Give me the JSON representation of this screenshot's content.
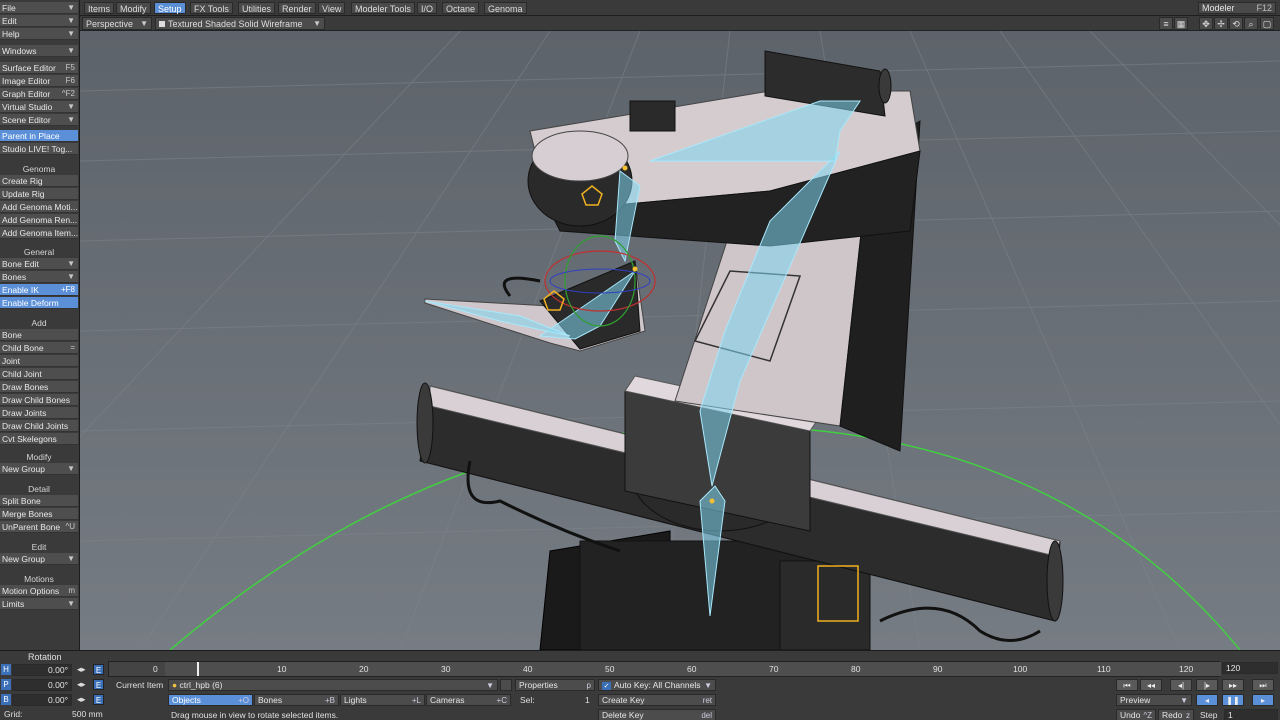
{
  "left_panel": {
    "menus": [
      {
        "label": "File"
      },
      {
        "label": "Edit"
      },
      {
        "label": "Help"
      },
      {
        "label": "Windows"
      }
    ],
    "editors": [
      {
        "label": "Surface Editor",
        "shortcut": "F5"
      },
      {
        "label": "Image Editor",
        "shortcut": "F6"
      },
      {
        "label": "Graph Editor",
        "shortcut": "^F2"
      },
      {
        "label": "Virtual Studio",
        "shortcut": ""
      },
      {
        "label": "Scene Editor",
        "shortcut": ""
      }
    ],
    "parent_in_place": "Parent in Place",
    "studio_live": "Studio LIVE! Tog...",
    "genoma_header": "Genoma",
    "genoma_items": [
      "Create Rig",
      "Update Rig",
      "Add Genoma Moti...",
      "Add Genoma Ren...",
      "Add Genoma Item..."
    ],
    "general_header": "General",
    "bone_edit": "Bone Edit",
    "bones": "Bones",
    "enable_ik": "Enable IK",
    "enable_ik_shortcut": "+F8",
    "enable_deform": "Enable Deform",
    "add_header": "Add",
    "add_items": [
      {
        "label": "Bone",
        "shortcut": ""
      },
      {
        "label": "Child Bone",
        "shortcut": "="
      },
      {
        "label": "Joint",
        "shortcut": ""
      },
      {
        "label": "Child Joint",
        "shortcut": ""
      },
      {
        "label": "Draw Bones",
        "shortcut": ""
      },
      {
        "label": "Draw Child Bones",
        "shortcut": ""
      },
      {
        "label": "Draw Joints",
        "shortcut": ""
      },
      {
        "label": "Draw Child Joints",
        "shortcut": ""
      },
      {
        "label": "Cvt Skelegons",
        "shortcut": ""
      }
    ],
    "modify_header": "Modify",
    "new_group_1": "New Group",
    "detail_header": "Detail",
    "split_bone": "Split Bone",
    "merge_bones": "Merge Bones",
    "unparent_bone": "UnParent Bone",
    "unparent_shortcut": "^U",
    "edit_header": "Edit",
    "new_group_2": "New Group",
    "motions_header": "Motions",
    "motion_options": "Motion Options",
    "motion_options_shortcut": "m",
    "limits": "Limits"
  },
  "top_tabs": [
    "Items",
    "Modify",
    "Setup",
    "FX Tools",
    "Utilities",
    "Render",
    "View",
    "Modeler Tools",
    "I/O",
    "Octane",
    "Genoma"
  ],
  "active_tab": "Setup",
  "layout": {
    "label": "Modeler",
    "shortcut": "F12"
  },
  "viewport_bar": {
    "view_mode": "Perspective",
    "render_mode": "Textured Shaded Solid Wireframe",
    "icons": [
      "list-icon",
      "grid-icon",
      "move-view-icon",
      "rotate-view-icon",
      "zoom-icon",
      "maximize-icon"
    ]
  },
  "timeline": {
    "ticks": [
      "0",
      "10",
      "20",
      "30",
      "40",
      "50",
      "60",
      "70",
      "80",
      "90",
      "100",
      "110",
      "120"
    ],
    "end_label": "120",
    "current_frame": 0,
    "frames_shown": [
      0,
      120
    ]
  },
  "bottom": {
    "rotation_label": "Rotation",
    "h_label": "H",
    "p_label": "P",
    "b_label": "B",
    "h_value": "0.00°",
    "p_value": "0.00°",
    "b_value": "0.00°",
    "e_label": "E",
    "grid_label": "Grid:",
    "grid_value": "500 mm",
    "current_item_label": "Current Item",
    "current_item_value": "ctrl_hpb (6)",
    "objects": "Objects",
    "objects_sc": "+O",
    "bones": "Bones",
    "bones_sc": "+B",
    "lights": "Lights",
    "lights_sc": "+L",
    "cameras": "Cameras",
    "cameras_sc": "+C",
    "status": "Drag mouse in view to rotate selected items.",
    "properties": "Properties",
    "properties_sc": "p",
    "sel_label": "Sel:",
    "sel_value": "1",
    "auto_key": "Auto Key: All Channels",
    "create_key": "Create Key",
    "create_key_sc": "ret",
    "delete_key": "Delete Key",
    "delete_key_sc": "del",
    "preview": "Preview",
    "undo": "Undo",
    "undo_sc": "^Z",
    "redo": "Redo",
    "redo_sc": "z",
    "step_label": "Step",
    "step_value": "1"
  },
  "colors": {
    "accent": "#5b90d8",
    "viewport_bg": "#6b7178",
    "bone_color": "#7fd6f0",
    "ik_circle": "#40d040"
  }
}
